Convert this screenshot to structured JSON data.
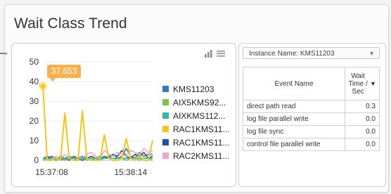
{
  "title": "Wait Class Trend",
  "tooltip": "37.653",
  "legend": [
    {
      "label": "KMS11203",
      "color": "#3a76c4"
    },
    {
      "label": "AIX5KMS92...",
      "color": "#7cc24c"
    },
    {
      "label": "AIXKMS112...",
      "color": "#2fb9a8"
    },
    {
      "label": "RAC1KMS11...",
      "color": "#f5c518"
    },
    {
      "label": "RAC1KMS11...",
      "color": "#2a4f9e"
    },
    {
      "label": "RAC2KMS11...",
      "color": "#f2a5c6"
    }
  ],
  "icons": [
    "bar-chart-icon",
    "menu-icon"
  ],
  "chart_data": {
    "type": "line",
    "title": "",
    "xlabel": "",
    "ylabel": "",
    "ylim": [
      0,
      50
    ],
    "yticks": [
      0,
      10,
      20,
      30,
      40,
      50
    ],
    "xtick_labels": [
      "15:37:08",
      "15:38:14"
    ],
    "tooltip_value": 37.653,
    "series": [
      {
        "name": "RAC1KMS11...",
        "color": "#f5c518",
        "values": [
          37.7,
          0,
          0,
          1,
          0,
          24,
          1,
          0,
          0,
          25,
          1,
          0,
          0,
          0,
          13,
          1,
          0,
          0,
          1,
          11,
          1,
          0,
          3,
          0,
          0,
          10
        ]
      },
      {
        "name": "KMS11203",
        "color": "#3a76c4",
        "values": [
          1,
          2,
          1,
          0,
          2,
          1,
          2,
          1,
          1,
          2,
          1,
          0,
          1,
          2,
          1,
          2,
          3,
          1,
          2,
          6,
          2,
          1,
          4,
          2,
          3,
          3
        ]
      },
      {
        "name": "RAC1KMS11...",
        "color": "#2a4f9e",
        "values": [
          0,
          1,
          2,
          1,
          0,
          1,
          0,
          2,
          1,
          0,
          1,
          2,
          1,
          0,
          2,
          1,
          3,
          2,
          5,
          2,
          1,
          3,
          2,
          4,
          1,
          2
        ]
      },
      {
        "name": "RAC2KMS11...",
        "color": "#f2a5c6",
        "values": [
          1,
          0,
          1,
          2,
          1,
          3,
          1,
          0,
          2,
          1,
          3,
          4,
          2,
          1,
          5,
          3,
          2,
          4,
          3,
          2,
          5,
          4,
          3,
          6,
          4,
          5
        ]
      },
      {
        "name": "AIX5KMS92...",
        "color": "#7cc24c",
        "values": [
          0,
          1,
          0,
          1,
          1,
          0,
          1,
          1,
          0,
          1,
          0,
          1,
          1,
          0,
          1,
          1,
          0,
          1,
          1,
          0,
          1,
          1,
          0,
          1,
          1,
          0
        ]
      },
      {
        "name": "AIXKMS112...",
        "color": "#2fb9a8",
        "values": [
          1,
          1,
          1,
          0,
          1,
          1,
          1,
          1,
          1,
          1,
          1,
          1,
          0,
          1,
          1,
          1,
          1,
          1,
          1,
          1,
          1,
          1,
          1,
          1,
          1,
          1
        ]
      }
    ]
  },
  "instance_select": {
    "label": "Instance Name: KMS11203",
    "caret": "▼"
  },
  "table": {
    "headers": [
      "Event Name",
      "Wait Time / Sec"
    ],
    "sort_indicator": "▼",
    "rows": [
      {
        "name": "direct path read",
        "value": "0.3"
      },
      {
        "name": "log file parallel write",
        "value": "0.0"
      },
      {
        "name": "log file sync",
        "value": "0.0"
      },
      {
        "name": "control file parallel write",
        "value": "0.0"
      }
    ]
  }
}
